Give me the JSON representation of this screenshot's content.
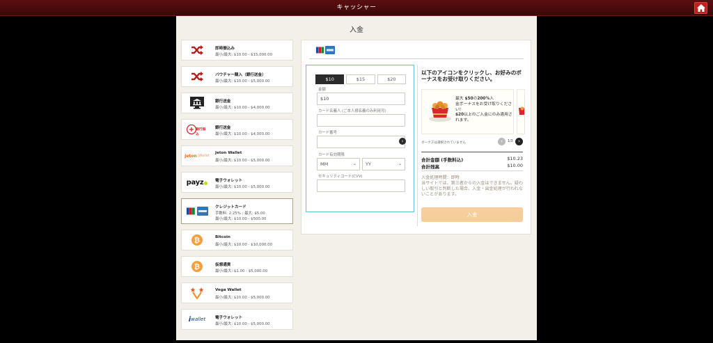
{
  "header": {
    "title": "キャッシャー",
    "home_icon": "home-icon"
  },
  "page": {
    "title": "入金"
  },
  "methods": [
    {
      "name": "即時振込み",
      "limit": "最小/最大: $10.00 - $15,000.00",
      "icon": "shuffle-icon"
    },
    {
      "name": "バウチャー購入（銀行送金）",
      "limit": "最小/最大: $10.00 - $5,000.00",
      "icon": "shuffle-icon"
    },
    {
      "name": "銀行送金",
      "limit": "最小/最大: $10.00 - $4,000.00",
      "icon": "bank-icon"
    },
    {
      "name": "銀行送金",
      "limit": "最小/最大: $10.00 - $4,000.00",
      "icon": "bank-transfer-logo",
      "logo_text": "銀行振込"
    },
    {
      "name": "Jeton Wallet",
      "limit": "最小/最大: $10.00 - $5,000.00",
      "icon": "jeton-logo",
      "logo_text": "Jeton"
    },
    {
      "name": "電子ウォレット",
      "limit": "最小/最大: $10.00 - $5,000.00",
      "icon": "payz-logo",
      "logo_text": "payz"
    },
    {
      "name": "クレジットカード",
      "fee": "手数料: 2.25% ; 最大: $5.00",
      "limit": "最小/最大: $10.00 - $500.00",
      "icon": "credit-card-logos",
      "selected": true
    },
    {
      "name": "Bitcoin",
      "limit": "最小/最大: $10.00 - $10,000.00",
      "icon": "bitcoin-icon"
    },
    {
      "name": "仮想通貨",
      "limit": "最小/最大: $1.00 - $5,000.00",
      "icon": "bitcoin-icon"
    },
    {
      "name": "Vega Wallet",
      "limit": "最小/最大: $10.00 - $5,000.00",
      "icon": "vega-logo"
    },
    {
      "name": "電子ウォレット",
      "limit": "最小/最大: $10.00 - $5,000.00",
      "icon": "iwallet-logo",
      "logo_text": "wallet"
    }
  ],
  "form": {
    "amount_options": [
      "$10",
      "$15",
      "$20"
    ],
    "amount_selected": "$10",
    "amount_label": "金額",
    "amount_value": "$10",
    "card_name_label": "カード名義人 (ご本人様名義のみ利用可)",
    "card_number_label": "カード番号",
    "expiry_label": "カード有効期限",
    "month_value": "MM",
    "year_value": "YY",
    "cvv_label": "セキュリティコード(CVV)"
  },
  "bonus": {
    "title": "以下のアイコンをクリックし、お好みのボーナスをお受け取りください。",
    "card_line1": "最大 ",
    "card_line1_b1": "$50",
    "card_line1_mid": "の",
    "card_line1_b2": "200%",
    "card_line1_end": "入",
    "card_line2": "金ボーナスをお受け取りください!",
    "card_line3_b": "$20",
    "card_line3": "以上のご入金にのみ適用されます。",
    "no_bonus": "ボーナスは選択されていません",
    "count": "1/3"
  },
  "summary": {
    "total_label": "合計金額 (手数料込)",
    "total_value": "$10.23",
    "balance_label": "合計残高",
    "balance_value": "$10.00"
  },
  "notes": {
    "line1": "入金処理時間：即時",
    "line2": "当サイトでは、第三者からの入金はできません。疑わしい取引と判断した場合、入金・出金処理が行われないことがあります。"
  },
  "deposit_button": "入金",
  "colors": {
    "accent": "#5cc6cf",
    "header": "#4a0b0c",
    "button": "#f7cd9c"
  }
}
